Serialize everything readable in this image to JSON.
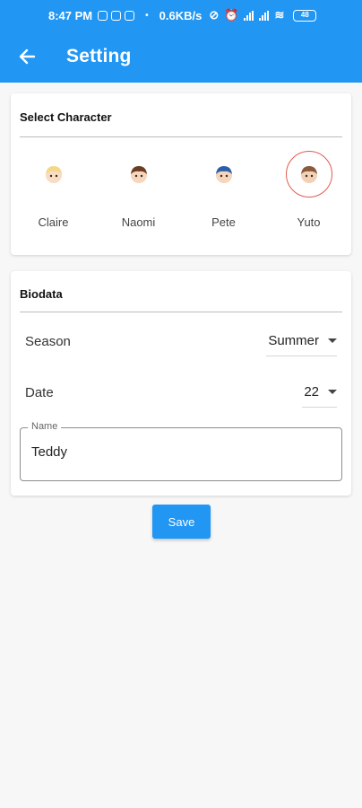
{
  "statusbar": {
    "time": "8:47 PM",
    "net_speed": "0.6KB/s",
    "battery": "48"
  },
  "appbar": {
    "title": "Setting"
  },
  "select_character": {
    "title": "Select Character",
    "characters": [
      {
        "name": "Claire",
        "selected": false,
        "hair": "#f3d88a",
        "skin": "#f9dcc4"
      },
      {
        "name": "Naomi",
        "selected": false,
        "hair": "#6b3d22",
        "skin": "#f6d6bd"
      },
      {
        "name": "Pete",
        "selected": false,
        "hair": "#2b5fa8",
        "skin": "#f5d5bc"
      },
      {
        "name": "Yuto",
        "selected": true,
        "hair": "#8a5a3c",
        "skin": "#f2d1b6"
      }
    ]
  },
  "biodata": {
    "title": "Biodata",
    "season_label": "Season",
    "season_value": "Summer",
    "date_label": "Date",
    "date_value": "22",
    "name_label": "Name",
    "name_value": "Teddy"
  },
  "actions": {
    "save_label": "Save"
  },
  "colors": {
    "primary": "#2196f3",
    "selected_ring": "#e05b50",
    "background": "#f7f7f7"
  }
}
